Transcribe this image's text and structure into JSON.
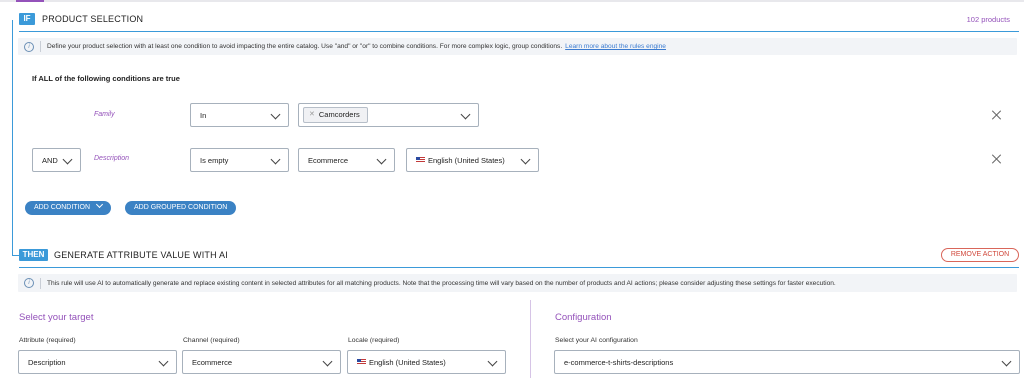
{
  "product_selection": {
    "if_tag": "IF",
    "title": "PRODUCT SELECTION",
    "product_count": "102 products",
    "info_text": "Define your product selection with at least one condition to avoid impacting the entire catalog. Use \"and\" or \"or\" to combine conditions. For more complex logic, group conditions.",
    "info_link": "Learn more about the rules engine",
    "conditions_heading": "If ALL of the following conditions are true",
    "conditions": [
      {
        "attribute": "Family",
        "operator": "In",
        "value_chip": "Camcorders"
      },
      {
        "connector": "AND",
        "attribute": "Description",
        "operator": "Is empty",
        "channel": "Ecommerce",
        "locale": "English (United States)"
      }
    ],
    "add_condition_label": "ADD CONDITION",
    "add_grouped_condition_label": "ADD GROUPED CONDITION"
  },
  "action": {
    "then_tag": "THEN",
    "title": "GENERATE ATTRIBUTE VALUE WITH AI",
    "remove_label": "REMOVE ACTION",
    "info_text": "This rule will use AI to automatically generate and replace existing content in selected attributes for all matching products. Note that the processing time will vary based on the number of products and AI actions; please consider adjusting these settings for faster execution.",
    "target": {
      "title": "Select your target",
      "attribute_label": "Attribute (required)",
      "attribute_value": "Description",
      "channel_label": "Channel (required)",
      "channel_value": "Ecommerce",
      "locale_label": "Locale (required)",
      "locale_value": "English (United States)"
    },
    "configuration": {
      "title": "Configuration",
      "ai_config_label": "Select your AI configuration",
      "ai_config_value": "e-commerce-t-shirts-descriptions"
    }
  },
  "colors": {
    "accent_purple": "#9452ba",
    "accent_blue": "#3b9ad9",
    "button_blue": "#3b82c4",
    "danger_red": "#d0473a"
  }
}
